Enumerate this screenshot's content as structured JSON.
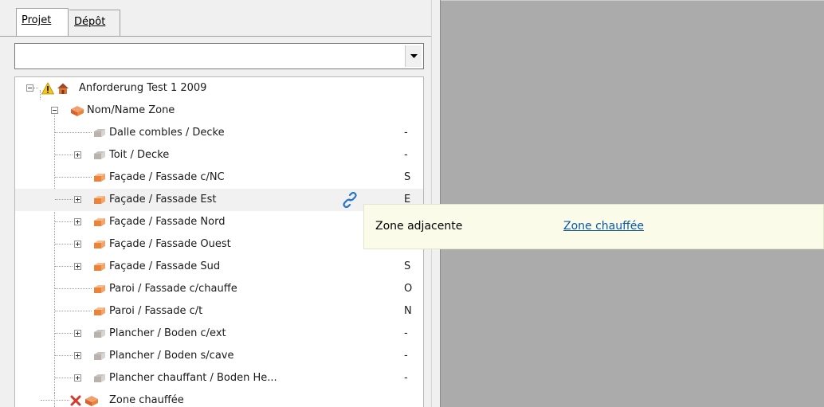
{
  "tabs": [
    {
      "label": "Projet",
      "active": true
    },
    {
      "label": "Dépôt",
      "active": false
    }
  ],
  "combo": {
    "value": ""
  },
  "tree": {
    "root": {
      "label": "Anforderung Test 1 2009",
      "icons": [
        "warning-icon",
        "house-icon"
      ]
    },
    "zone": {
      "label": "Nom/Name Zone",
      "icon": "zone-icon"
    },
    "items": [
      {
        "label": "Dalle combles / Decke",
        "orientation": "-",
        "expandable": false,
        "icon": "wall-gray-icon"
      },
      {
        "label": "Toit / Decke",
        "orientation": "-",
        "expandable": true,
        "icon": "wall-gray-icon"
      },
      {
        "label": "Façade / Fassade c/NC",
        "orientation": "S",
        "expandable": false,
        "icon": "wall-orange-icon"
      },
      {
        "label": "Façade / Fassade Est",
        "orientation": "E",
        "expandable": true,
        "icon": "wall-orange-icon"
      },
      {
        "label": "Façade / Fassade Nord",
        "orientation": "",
        "expandable": true,
        "icon": "wall-orange-icon"
      },
      {
        "label": "Façade / Fassade Ouest",
        "orientation": "",
        "expandable": true,
        "icon": "wall-orange-icon"
      },
      {
        "label": "Façade / Fassade Sud",
        "orientation": "S",
        "expandable": true,
        "icon": "wall-orange-icon"
      },
      {
        "label": "Paroi / Fassade c/chauffe",
        "orientation": "O",
        "expandable": false,
        "icon": "wall-orange-icon"
      },
      {
        "label": "Paroi / Fassade c/t",
        "orientation": "N",
        "expandable": false,
        "icon": "wall-orange-icon"
      },
      {
        "label": "Plancher / Boden c/ext",
        "orientation": "-",
        "expandable": true,
        "icon": "wall-gray-icon"
      },
      {
        "label": "Plancher / Boden s/cave",
        "orientation": "-",
        "expandable": true,
        "icon": "wall-gray-icon"
      },
      {
        "label": "Plancher chauffant / Boden He...",
        "orientation": "-",
        "expandable": true,
        "icon": "wall-gray-icon"
      }
    ],
    "last": {
      "label": "Zone chauffée",
      "icons": [
        "error-x-icon",
        "zone-icon"
      ]
    }
  },
  "tooltip": {
    "label": "Zone adjacente",
    "value": "Zone chauffée"
  },
  "colors": {
    "orange": "#e8843c",
    "gray": "#b9b2ad",
    "link": "#0b57a8",
    "tooltip_bg": "#fbfbe9",
    "workspace": "#ababab"
  }
}
